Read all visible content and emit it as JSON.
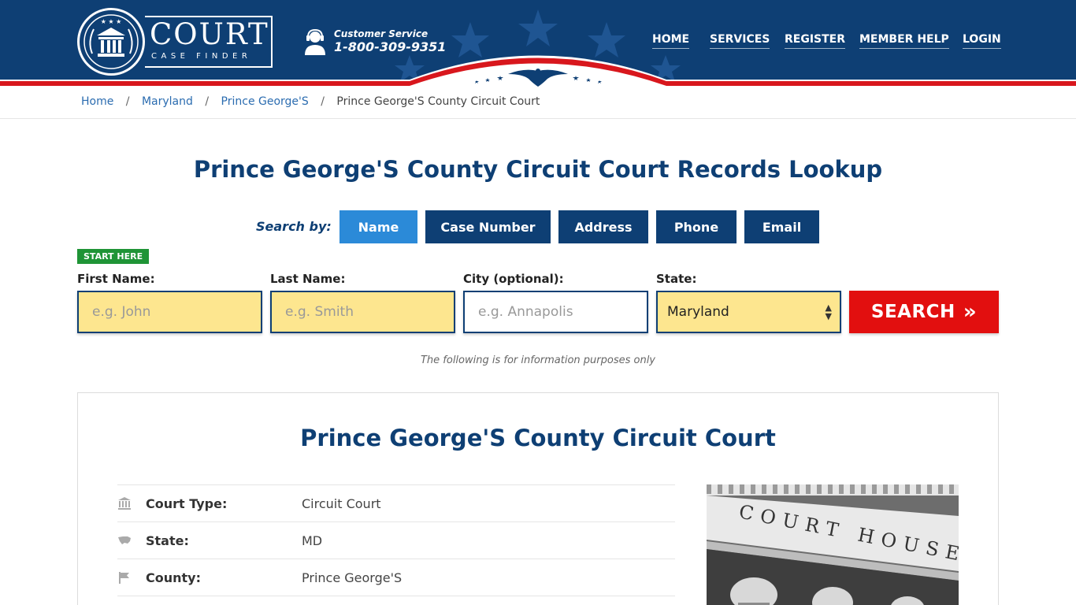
{
  "header": {
    "logo": {
      "title": "COURT",
      "subtitle": "CASE FINDER"
    },
    "customer_service": {
      "label": "Customer Service",
      "phone": "1-800-309-9351"
    },
    "nav": [
      "HOME",
      "SERVICES",
      "REGISTER",
      "MEMBER HELP",
      "LOGIN"
    ],
    "colors": {
      "navy": "#0e3f74",
      "red": "#e20f0f",
      "white": "#ffffff"
    }
  },
  "breadcrumb": {
    "items": [
      "Home",
      "Maryland",
      "Prince George'S"
    ],
    "current": "Prince George'S County Circuit Court",
    "separator": "/"
  },
  "page": {
    "title": "Prince George'S County Circuit Court Records Lookup"
  },
  "search": {
    "search_by_label": "Search by:",
    "tabs": [
      "Name",
      "Case Number",
      "Address",
      "Phone",
      "Email"
    ],
    "active_tab": "Name",
    "start_here": "START HERE",
    "fields": {
      "first_name": {
        "label": "First Name:",
        "placeholder": "e.g. John"
      },
      "last_name": {
        "label": "Last Name:",
        "placeholder": "e.g. Smith"
      },
      "city": {
        "label": "City (optional):",
        "placeholder": "e.g.  Annapolis"
      },
      "state": {
        "label": "State:",
        "value": "Maryland"
      }
    },
    "button": "SEARCH",
    "note": "The following is for information purposes only"
  },
  "court": {
    "title": "Prince George'S County Circuit Court",
    "rows": [
      {
        "icon": "building-icon",
        "label": "Court Type:",
        "value": "Circuit Court"
      },
      {
        "icon": "usa-map-icon",
        "label": "State:",
        "value": "MD"
      },
      {
        "icon": "flag-icon",
        "label": "County:",
        "value": "Prince George'S"
      }
    ],
    "photo_text": "COURT HOUSE"
  }
}
